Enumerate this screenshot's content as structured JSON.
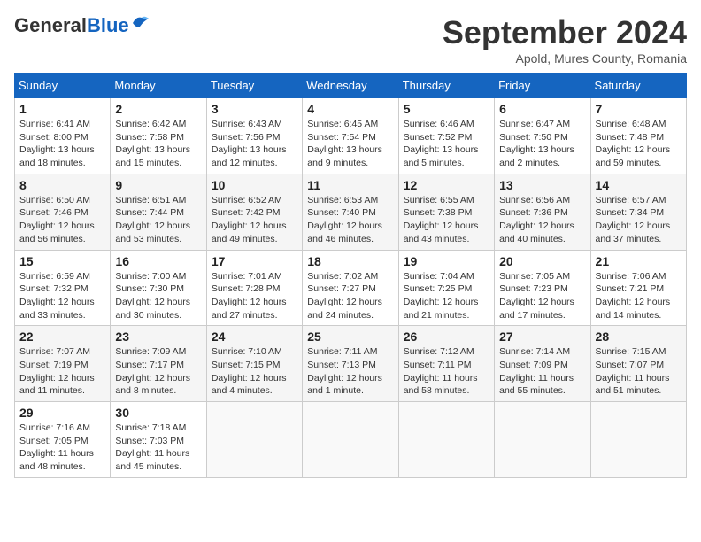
{
  "header": {
    "logo_general": "General",
    "logo_blue": "Blue",
    "month_title": "September 2024",
    "location": "Apold, Mures County, Romania"
  },
  "weekdays": [
    "Sunday",
    "Monday",
    "Tuesday",
    "Wednesday",
    "Thursday",
    "Friday",
    "Saturday"
  ],
  "weeks": [
    [
      {
        "day": "1",
        "detail": "Sunrise: 6:41 AM\nSunset: 8:00 PM\nDaylight: 13 hours\nand 18 minutes."
      },
      {
        "day": "2",
        "detail": "Sunrise: 6:42 AM\nSunset: 7:58 PM\nDaylight: 13 hours\nand 15 minutes."
      },
      {
        "day": "3",
        "detail": "Sunrise: 6:43 AM\nSunset: 7:56 PM\nDaylight: 13 hours\nand 12 minutes."
      },
      {
        "day": "4",
        "detail": "Sunrise: 6:45 AM\nSunset: 7:54 PM\nDaylight: 13 hours\nand 9 minutes."
      },
      {
        "day": "5",
        "detail": "Sunrise: 6:46 AM\nSunset: 7:52 PM\nDaylight: 13 hours\nand 5 minutes."
      },
      {
        "day": "6",
        "detail": "Sunrise: 6:47 AM\nSunset: 7:50 PM\nDaylight: 13 hours\nand 2 minutes."
      },
      {
        "day": "7",
        "detail": "Sunrise: 6:48 AM\nSunset: 7:48 PM\nDaylight: 12 hours\nand 59 minutes."
      }
    ],
    [
      {
        "day": "8",
        "detail": "Sunrise: 6:50 AM\nSunset: 7:46 PM\nDaylight: 12 hours\nand 56 minutes."
      },
      {
        "day": "9",
        "detail": "Sunrise: 6:51 AM\nSunset: 7:44 PM\nDaylight: 12 hours\nand 53 minutes."
      },
      {
        "day": "10",
        "detail": "Sunrise: 6:52 AM\nSunset: 7:42 PM\nDaylight: 12 hours\nand 49 minutes."
      },
      {
        "day": "11",
        "detail": "Sunrise: 6:53 AM\nSunset: 7:40 PM\nDaylight: 12 hours\nand 46 minutes."
      },
      {
        "day": "12",
        "detail": "Sunrise: 6:55 AM\nSunset: 7:38 PM\nDaylight: 12 hours\nand 43 minutes."
      },
      {
        "day": "13",
        "detail": "Sunrise: 6:56 AM\nSunset: 7:36 PM\nDaylight: 12 hours\nand 40 minutes."
      },
      {
        "day": "14",
        "detail": "Sunrise: 6:57 AM\nSunset: 7:34 PM\nDaylight: 12 hours\nand 37 minutes."
      }
    ],
    [
      {
        "day": "15",
        "detail": "Sunrise: 6:59 AM\nSunset: 7:32 PM\nDaylight: 12 hours\nand 33 minutes."
      },
      {
        "day": "16",
        "detail": "Sunrise: 7:00 AM\nSunset: 7:30 PM\nDaylight: 12 hours\nand 30 minutes."
      },
      {
        "day": "17",
        "detail": "Sunrise: 7:01 AM\nSunset: 7:28 PM\nDaylight: 12 hours\nand 27 minutes."
      },
      {
        "day": "18",
        "detail": "Sunrise: 7:02 AM\nSunset: 7:27 PM\nDaylight: 12 hours\nand 24 minutes."
      },
      {
        "day": "19",
        "detail": "Sunrise: 7:04 AM\nSunset: 7:25 PM\nDaylight: 12 hours\nand 21 minutes."
      },
      {
        "day": "20",
        "detail": "Sunrise: 7:05 AM\nSunset: 7:23 PM\nDaylight: 12 hours\nand 17 minutes."
      },
      {
        "day": "21",
        "detail": "Sunrise: 7:06 AM\nSunset: 7:21 PM\nDaylight: 12 hours\nand 14 minutes."
      }
    ],
    [
      {
        "day": "22",
        "detail": "Sunrise: 7:07 AM\nSunset: 7:19 PM\nDaylight: 12 hours\nand 11 minutes."
      },
      {
        "day": "23",
        "detail": "Sunrise: 7:09 AM\nSunset: 7:17 PM\nDaylight: 12 hours\nand 8 minutes."
      },
      {
        "day": "24",
        "detail": "Sunrise: 7:10 AM\nSunset: 7:15 PM\nDaylight: 12 hours\nand 4 minutes."
      },
      {
        "day": "25",
        "detail": "Sunrise: 7:11 AM\nSunset: 7:13 PM\nDaylight: 12 hours\nand 1 minute."
      },
      {
        "day": "26",
        "detail": "Sunrise: 7:12 AM\nSunset: 7:11 PM\nDaylight: 11 hours\nand 58 minutes."
      },
      {
        "day": "27",
        "detail": "Sunrise: 7:14 AM\nSunset: 7:09 PM\nDaylight: 11 hours\nand 55 minutes."
      },
      {
        "day": "28",
        "detail": "Sunrise: 7:15 AM\nSunset: 7:07 PM\nDaylight: 11 hours\nand 51 minutes."
      }
    ],
    [
      {
        "day": "29",
        "detail": "Sunrise: 7:16 AM\nSunset: 7:05 PM\nDaylight: 11 hours\nand 48 minutes."
      },
      {
        "day": "30",
        "detail": "Sunrise: 7:18 AM\nSunset: 7:03 PM\nDaylight: 11 hours\nand 45 minutes."
      },
      {
        "day": "",
        "detail": ""
      },
      {
        "day": "",
        "detail": ""
      },
      {
        "day": "",
        "detail": ""
      },
      {
        "day": "",
        "detail": ""
      },
      {
        "day": "",
        "detail": ""
      }
    ]
  ]
}
